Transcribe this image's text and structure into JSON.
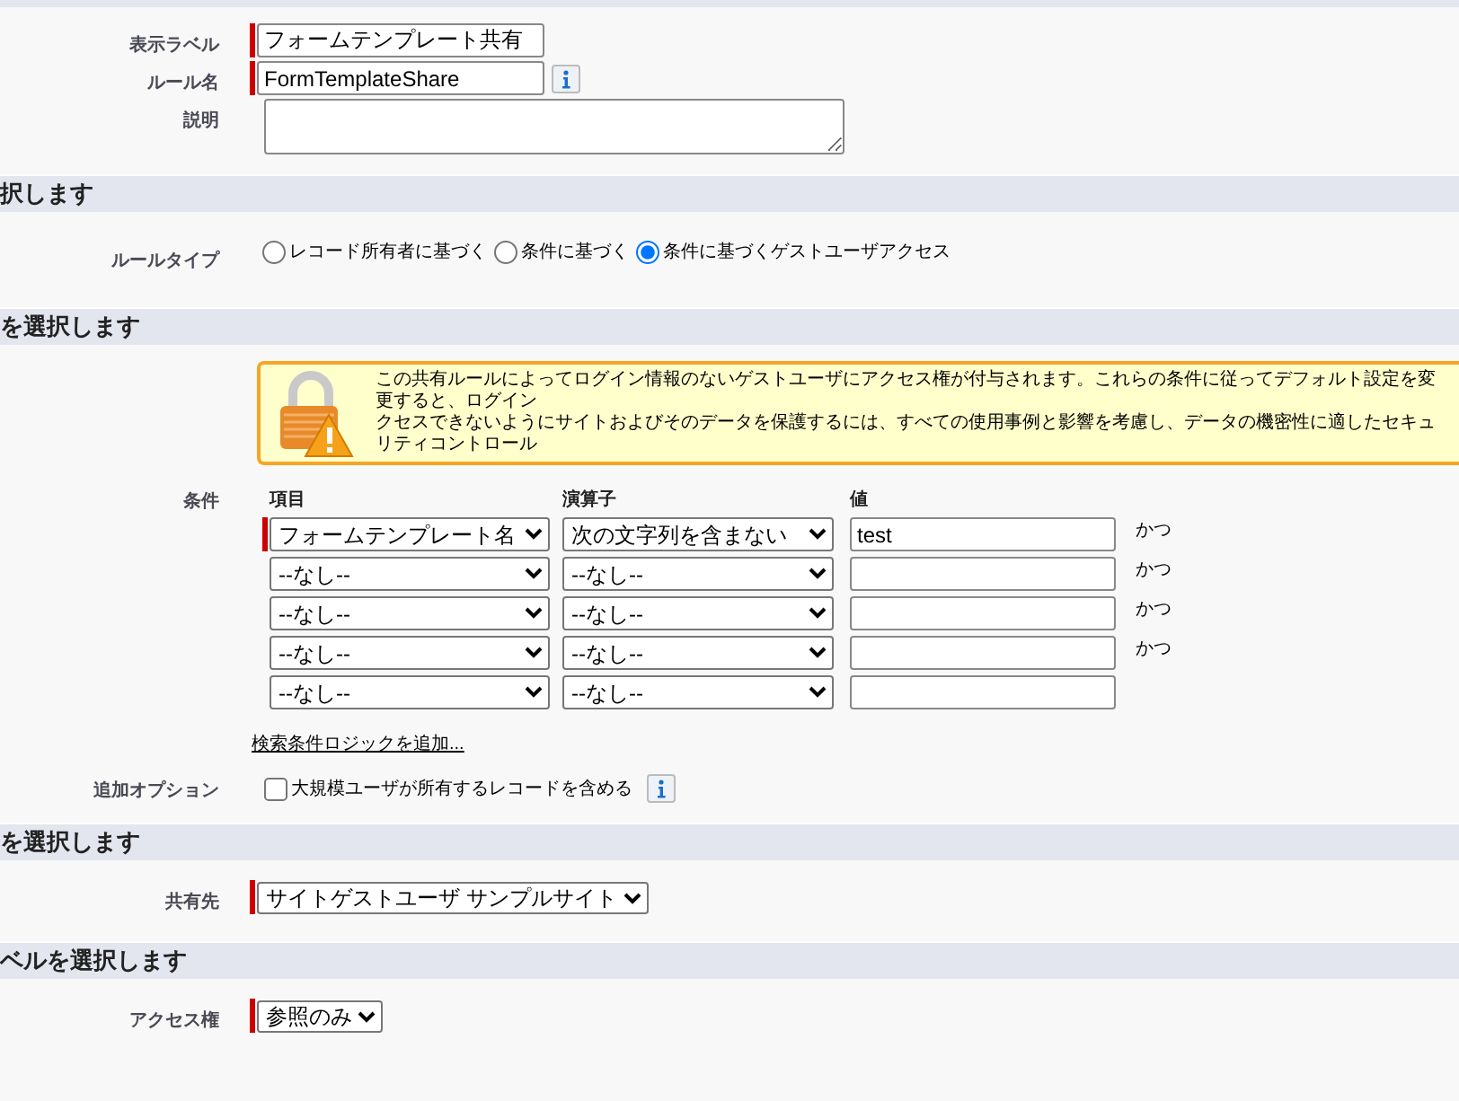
{
  "sections": [
    {
      "rows": [
        {
          "kind": "text",
          "label": "表示ラベル",
          "value": "フォームテンプレート共有",
          "required": true
        },
        {
          "kind": "text",
          "label": "ルール名",
          "value": "FormTemplateShare",
          "required": true,
          "info": true
        },
        {
          "kind": "textarea",
          "label": "説明"
        }
      ]
    },
    {
      "heading": "択します",
      "rows": [
        {
          "kind": "radio",
          "label": "ルールタイプ",
          "options": [
            {
              "label": "レコード所有者に基づく",
              "selected": false
            },
            {
              "label": "条件に基づく",
              "selected": false
            },
            {
              "label": "条件に基づくゲストユーザアクセス",
              "selected": true
            }
          ]
        }
      ]
    },
    {
      "heading": "を選択します",
      "rows": [
        {
          "kind": "warning",
          "lines": [
            "この共有ルールによってログイン情報のないゲストユーザにアクセス権が付与されます。これらの条件に従ってデフォルト設定を変更すると、ログイン",
            "クセスできないようにサイトおよびそのデータを保護するには、すべての使用事例と影響を考慮し、データの機密性に適したセキュリティコントロール"
          ]
        },
        {
          "kind": "criteria",
          "label": "条件",
          "columns": [
            "項目",
            "演算子",
            "値"
          ],
          "criteria": [
            {
              "field": "フォームテンプレート名",
              "operator": "次の文字列を含まない",
              "value": "test",
              "connector": "かつ",
              "required": true
            },
            {
              "field": "--なし--",
              "operator": "--なし--",
              "connector": "かつ",
              "required": false
            },
            {
              "field": "--なし--",
              "operator": "--なし--",
              "connector": "かつ",
              "required": false
            },
            {
              "field": "--なし--",
              "operator": "--なし--",
              "connector": "かつ",
              "required": false
            },
            {
              "field": "--なし--",
              "operator": "--なし--",
              "required": false
            }
          ],
          "link": "検索条件ロジックを追加..."
        },
        {
          "kind": "checkbox",
          "label": "追加オプション",
          "text": "大規模ユーザが所有するレコードを含める",
          "checked": false,
          "info": true
        }
      ]
    },
    {
      "heading": "を選択します",
      "rows": [
        {
          "kind": "select",
          "label": "共有先",
          "value": "サイトゲストユーザ サンプルサイト",
          "required": true
        }
      ]
    },
    {
      "heading": "ベルを選択します",
      "rows": [
        {
          "kind": "select",
          "label": "アクセス権",
          "value": "参照のみ",
          "required": true
        }
      ]
    }
  ]
}
